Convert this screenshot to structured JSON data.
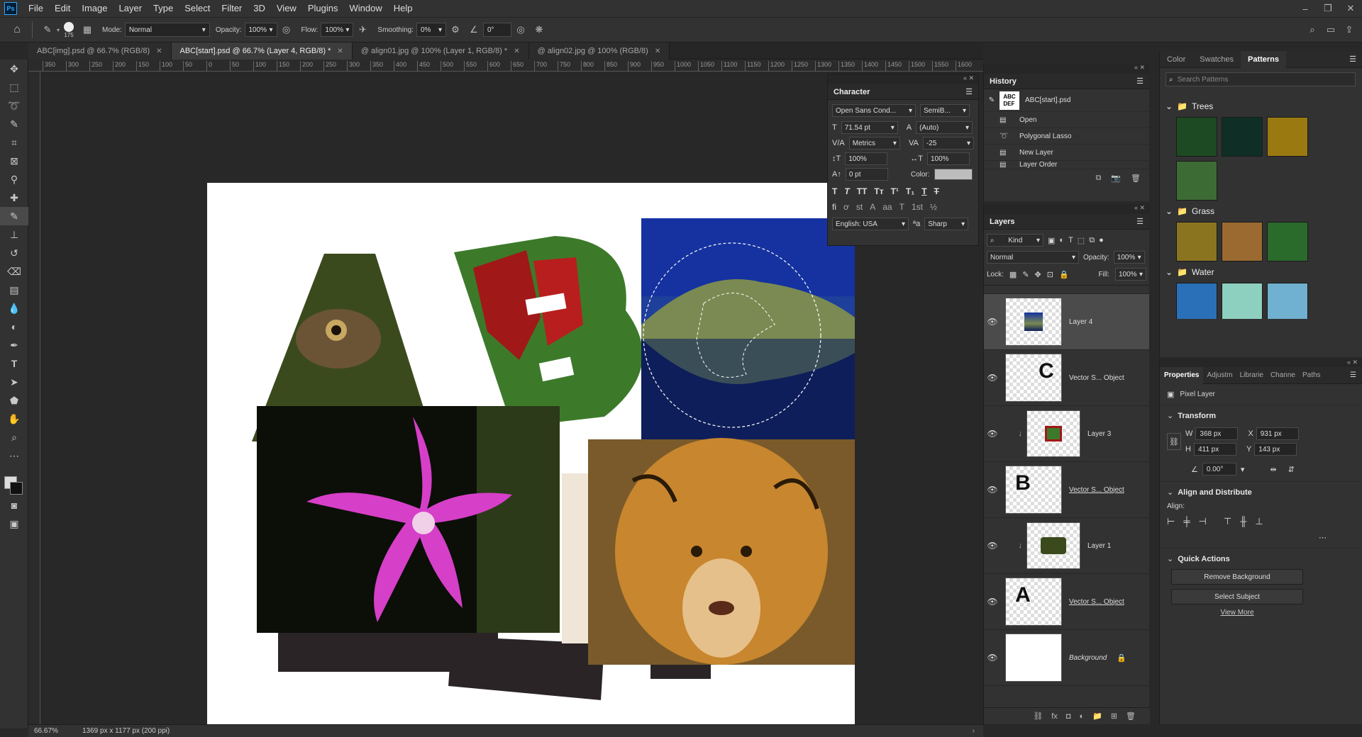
{
  "app": {
    "logo": "Ps"
  },
  "menu": [
    "File",
    "Edit",
    "Image",
    "Layer",
    "Type",
    "Select",
    "Filter",
    "3D",
    "View",
    "Plugins",
    "Window",
    "Help"
  ],
  "options": {
    "brush_size": "175",
    "mode_label": "Mode:",
    "mode_value": "Normal",
    "opacity_label": "Opacity:",
    "opacity_value": "100%",
    "flow_label": "Flow:",
    "flow_value": "100%",
    "smoothing_label": "Smoothing:",
    "smoothing_value": "0%",
    "angle_value": "0°"
  },
  "tabs": [
    {
      "label": "ABC[img].psd @ 66.7% (RGB/8)"
    },
    {
      "label": "ABC[start].psd @ 66.7% (Layer 4, RGB/8) *"
    },
    {
      "label": "@ align01.jpg @ 100% (Layer 1, RGB/8) *"
    },
    {
      "label": "@ align02.jpg @ 100% (RGB/8)"
    }
  ],
  "ruler_labels": [
    "350",
    "300",
    "250",
    "200",
    "150",
    "100",
    "50",
    "0",
    "50",
    "100",
    "150",
    "200",
    "250",
    "300",
    "350",
    "400",
    "450",
    "500",
    "550",
    "600",
    "650",
    "700",
    "750",
    "800",
    "850",
    "900",
    "950",
    "1000",
    "1050",
    "1100",
    "1150",
    "1200",
    "1250",
    "1300",
    "1350",
    "1400",
    "1450",
    "1500",
    "1550",
    "1600"
  ],
  "status": {
    "zoom": "66.67%",
    "doc_info": "1369 px x 1177 px (200 ppi)"
  },
  "character": {
    "title": "Character",
    "font_family": "Open Sans Cond...",
    "font_style": "SemiB...",
    "font_size": "71.54 pt",
    "leading": "(Auto)",
    "kerning": "Metrics",
    "tracking": "-25",
    "vscale": "100%",
    "hscale": "100%",
    "baseline": "0 pt",
    "color_label": "Color:",
    "language": "English: USA",
    "antialias": "Sharp"
  },
  "history": {
    "title": "History",
    "snapshot": "ABC[start].psd",
    "items": [
      "Open",
      "Polygonal Lasso",
      "New Layer",
      "Layer Order"
    ]
  },
  "layers": {
    "title": "Layers",
    "kind": "Kind",
    "blend": "Normal",
    "opacity_label": "Opacity:",
    "opacity_value": "100%",
    "lock_label": "Lock:",
    "fill_label": "Fill:",
    "fill_value": "100%",
    "items": [
      {
        "name": "Layer 4"
      },
      {
        "name": "Vector S... Object",
        "glyph": "C"
      },
      {
        "name": "Layer 3"
      },
      {
        "name": "Vector S... Object",
        "glyph": "B"
      },
      {
        "name": "Layer 1"
      },
      {
        "name": "Vector S... Object",
        "glyph": "A"
      },
      {
        "name": "Background"
      }
    ]
  },
  "patterns": {
    "tabs": [
      "Color",
      "Swatches",
      "Patterns"
    ],
    "search_placeholder": "Search Patterns",
    "groups": [
      {
        "name": "Trees",
        "swatches": [
          "#1d4a22",
          "#0f2f26",
          "#9a7a10",
          "#3d6b34"
        ]
      },
      {
        "name": "Grass",
        "swatches": [
          "#8a7420",
          "#9a6a30",
          "#2a6a2a"
        ]
      },
      {
        "name": "Water",
        "swatches": [
          "#2a70b8",
          "#8ed0c0",
          "#70b0d0"
        ]
      }
    ]
  },
  "properties": {
    "tabs": [
      "Properties",
      "Adjustm",
      "Librarie",
      "Channe",
      "Paths"
    ],
    "kind": "Pixel Layer",
    "transform_title": "Transform",
    "w_label": "W",
    "w": "368 px",
    "h_label": "H",
    "h": "411 px",
    "x_label": "X",
    "x": "931 px",
    "y_label": "Y",
    "y": "143 px",
    "angle": "0.00°",
    "align_title": "Align and Distribute",
    "align_label": "Align:",
    "quick_title": "Quick Actions",
    "remove_bg": "Remove Background",
    "select_subject": "Select Subject",
    "view_more": "View More"
  }
}
